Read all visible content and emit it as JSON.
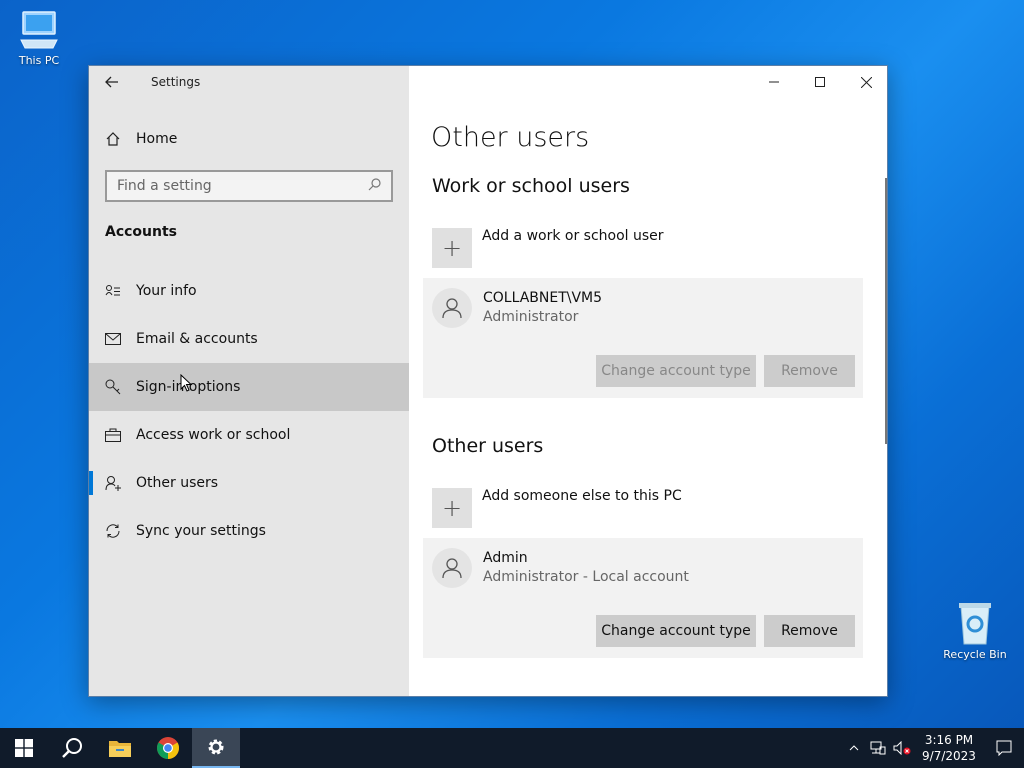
{
  "desktop": {
    "icons": [
      {
        "label": "This PC"
      },
      {
        "label": "Recycle Bin"
      }
    ]
  },
  "window": {
    "app_title": "Settings",
    "controls": {
      "minimize": "minimize-icon",
      "maximize": "maximize-icon",
      "close": "close-icon"
    }
  },
  "sidebar": {
    "home_label": "Home",
    "search_placeholder": "Find a setting",
    "section_title": "Accounts",
    "items": [
      {
        "label": "Your info",
        "icon": "contact-card-icon"
      },
      {
        "label": "Email & accounts",
        "icon": "mail-icon"
      },
      {
        "label": "Sign-in options",
        "icon": "key-icon"
      },
      {
        "label": "Access work or school",
        "icon": "briefcase-icon"
      },
      {
        "label": "Other users",
        "icon": "add-person-icon"
      },
      {
        "label": "Sync your settings",
        "icon": "sync-icon"
      }
    ],
    "active_item": "Other users",
    "hover_item": "Sign-in options"
  },
  "main": {
    "page_title": "Other users",
    "work_section": {
      "title": "Work or school users",
      "add_label": "Add a work or school user",
      "user": {
        "name": "COLLABNET\\VM5",
        "role": "Administrator",
        "change_label": "Change account type",
        "remove_label": "Remove",
        "buttons_enabled": false
      }
    },
    "other_section": {
      "title": "Other users",
      "add_label": "Add someone else to this PC",
      "user": {
        "name": "Admin",
        "role": "Administrator - Local account",
        "change_label": "Change account type",
        "remove_label": "Remove",
        "buttons_enabled": true
      }
    }
  },
  "taskbar": {
    "pinned": [
      "start-icon",
      "search-icon",
      "file-explorer-icon",
      "chrome-icon",
      "settings-icon"
    ],
    "time": "3:16 PM",
    "date": "9/7/2023"
  },
  "colors": {
    "accent": "#0078d7",
    "sidebar_bg": "#e6e6e6",
    "taskbar_bg": "#101b2a"
  }
}
